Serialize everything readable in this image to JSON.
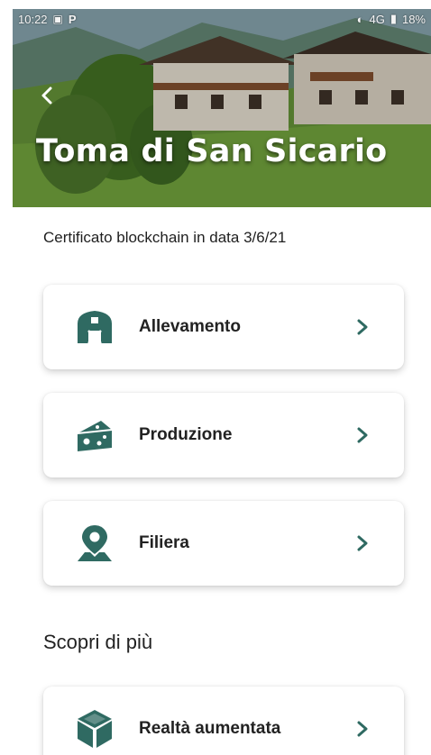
{
  "status_bar": {
    "time": "10:22",
    "right": "4G",
    "battery": "18%"
  },
  "header": {
    "title": "Toma di San Sicario"
  },
  "certificate_text": "Certificato blockchain in data 3/6/21",
  "cards": [
    {
      "label": "Allevamento",
      "icon": "barn-icon"
    },
    {
      "label": "Produzione",
      "icon": "cheese-icon"
    },
    {
      "label": "Filiera",
      "icon": "map-pin-icon"
    }
  ],
  "discover": {
    "title": "Scopri di più",
    "cards": [
      {
        "label": "Realtà aumentata",
        "icon": "cube-icon"
      }
    ]
  },
  "colors": {
    "accent": "#2f6a62",
    "text": "#222222"
  }
}
